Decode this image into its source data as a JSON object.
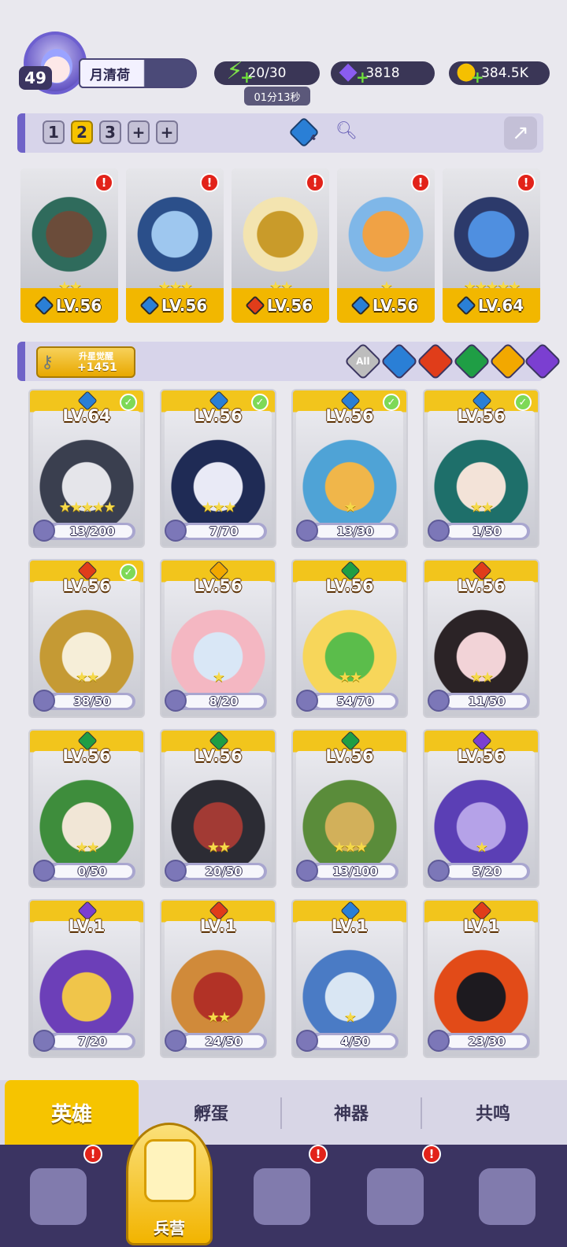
{
  "player": {
    "level": "49",
    "name": "月清荷"
  },
  "resources": {
    "energy": "20/30",
    "energy_timer": "01分13秒",
    "gems": "3818",
    "gold": "384.5K"
  },
  "team_tabs": [
    "1",
    "2",
    "3",
    "+",
    "+"
  ],
  "team_bar": {
    "crystal_count": "4"
  },
  "team": [
    {
      "level": "LV.56",
      "stars": "★★",
      "element": "water",
      "alert": "!"
    },
    {
      "level": "LV.56",
      "stars": "★★★",
      "element": "water",
      "alert": "!"
    },
    {
      "level": "LV.56",
      "stars": "★★",
      "element": "fire",
      "alert": "!"
    },
    {
      "level": "LV.56",
      "stars": "★",
      "element": "water",
      "alert": "!"
    },
    {
      "level": "LV.64",
      "stars": "★★★★★",
      "element": "water",
      "alert": "!"
    }
  ],
  "awaken": {
    "title": "升星觉醒",
    "value": "+1451"
  },
  "filters": [
    "All",
    "water",
    "fire",
    "wind",
    "light",
    "dark"
  ],
  "filter_all_label": "All",
  "heroes": [
    {
      "level": "LV.64",
      "frag": "13/200",
      "stars": "★★★★★",
      "element": "water",
      "check": "✓"
    },
    {
      "level": "LV.56",
      "frag": "7/70",
      "stars": "★★★",
      "element": "water",
      "check": "✓"
    },
    {
      "level": "LV.56",
      "frag": "13/30",
      "stars": "★",
      "element": "water",
      "check": "✓"
    },
    {
      "level": "LV.56",
      "frag": "1/50",
      "stars": "★★",
      "element": "water",
      "check": "✓"
    },
    {
      "level": "LV.56",
      "frag": "38/50",
      "stars": "★★",
      "element": "fire",
      "check": "✓"
    },
    {
      "level": "LV.56",
      "frag": "8/20",
      "stars": "★",
      "element": "light",
      "check": ""
    },
    {
      "level": "LV.56",
      "frag": "54/70",
      "stars": "★★",
      "element": "wind",
      "check": ""
    },
    {
      "level": "LV.56",
      "frag": "11/50",
      "stars": "★★",
      "element": "fire",
      "check": ""
    },
    {
      "level": "LV.56",
      "frag": "0/50",
      "stars": "★★",
      "element": "wind",
      "check": ""
    },
    {
      "level": "LV.56",
      "frag": "20/50",
      "stars": "★★",
      "element": "wind",
      "check": ""
    },
    {
      "level": "LV.56",
      "frag": "13/100",
      "stars": "★★★",
      "element": "wind",
      "check": ""
    },
    {
      "level": "LV.56",
      "frag": "5/20",
      "stars": "★",
      "element": "dark",
      "check": ""
    },
    {
      "level": "LV.1",
      "frag": "7/20",
      "stars": "",
      "element": "dark",
      "check": ""
    },
    {
      "level": "LV.1",
      "frag": "24/50",
      "stars": "★★",
      "element": "fire",
      "check": ""
    },
    {
      "level": "LV.1",
      "frag": "4/50",
      "stars": "★",
      "element": "water",
      "check": ""
    },
    {
      "level": "LV.1",
      "frag": "23/30",
      "stars": "",
      "element": "fire",
      "check": ""
    }
  ],
  "sub_tabs": [
    "英雄",
    "孵蛋",
    "神器",
    "共鸣"
  ],
  "nav": {
    "active_label": "兵营",
    "alerts": [
      "!",
      "!",
      "!"
    ]
  },
  "colors": {
    "water": "#2a7fd6",
    "fire": "#e03d1a",
    "wind": "#1f9e45",
    "light": "#f2a800",
    "dark": "#7b3fd1",
    "accent": "#f6c400"
  }
}
